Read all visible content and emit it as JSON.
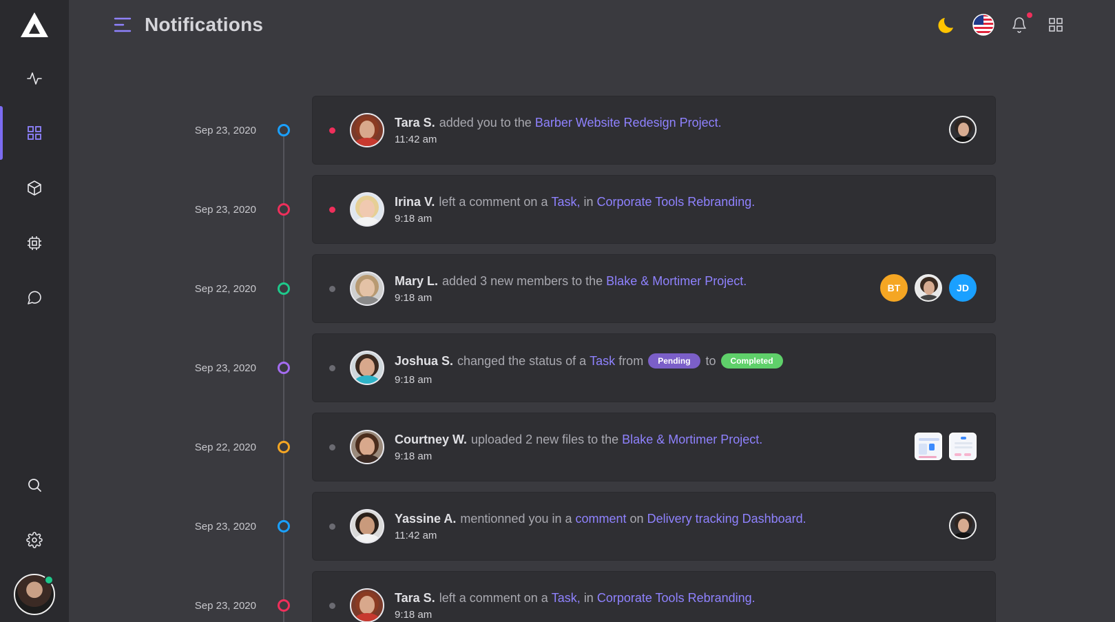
{
  "header": {
    "title": "Notifications",
    "icons": [
      "menu-icon",
      "moon-icon",
      "us-flag-icon",
      "bell-icon",
      "apps-grid-icon"
    ]
  },
  "sidebar": {
    "items": [
      "activity-icon",
      "grid-icon",
      "cube-icon",
      "chip-icon",
      "chat-icon",
      "search-icon",
      "gear-icon"
    ],
    "active": "grid-icon"
  },
  "colors": {
    "accent": "#8f82ff",
    "unread": "#ef2f5b",
    "read": "#6b6b72",
    "pending": "#7b5fc8",
    "completed": "#5fd06a"
  },
  "notifications": [
    {
      "date": "Sep 23, 2020",
      "dot_color": "#1aa0ff",
      "unread": true,
      "name": "Tara S.",
      "pre": "added you to the",
      "link1": "Barber Website Redesign Project.",
      "time": "11:42 am"
    },
    {
      "date": "Sep 23, 2020",
      "dot_color": "#ef2f5b",
      "unread": true,
      "name": "Irina V.",
      "pre": "left a comment on a",
      "link1": "Task,",
      "mid": "in",
      "link2": "Corporate Tools Rebranding.",
      "time": "9:18 am"
    },
    {
      "date": "Sep 22, 2020",
      "dot_color": "#1ec98b",
      "unread": false,
      "name": "Mary L.",
      "pre": "added 3 new members to the",
      "link1": "Blake & Mortimer Project.",
      "time": "9:18 am",
      "members": [
        "BT",
        "",
        "JD"
      ]
    },
    {
      "date": "Sep 23, 2020",
      "dot_color": "#a46cf0",
      "unread": false,
      "name": "Joshua S.",
      "pre": "changed the status of a",
      "link1": "Task",
      "mid": "from",
      "status_from": "Pending",
      "to": "to",
      "status_to": "Completed",
      "time": "9:18 am"
    },
    {
      "date": "Sep 22, 2020",
      "dot_color": "#f5a623",
      "unread": false,
      "name": "Courtney W.",
      "pre": "uploaded 2 new files to the",
      "link1": "Blake & Mortimer Project.",
      "time": "9:18 am"
    },
    {
      "date": "Sep 23, 2020",
      "dot_color": "#1aa0ff",
      "unread": false,
      "name": "Yassine A.",
      "pre": "mentionned you in a",
      "link1": "comment",
      "mid": "on",
      "link2": "Delivery tracking Dashboard.",
      "time": "11:42 am"
    },
    {
      "date": "Sep 23, 2020",
      "dot_color": "#ef2f5b",
      "unread": false,
      "name": "Tara S.",
      "pre": "left a comment on a",
      "link1": "Task,",
      "mid": "in",
      "link2": "Corporate Tools Rebranding.",
      "time": "9:18 am"
    }
  ]
}
